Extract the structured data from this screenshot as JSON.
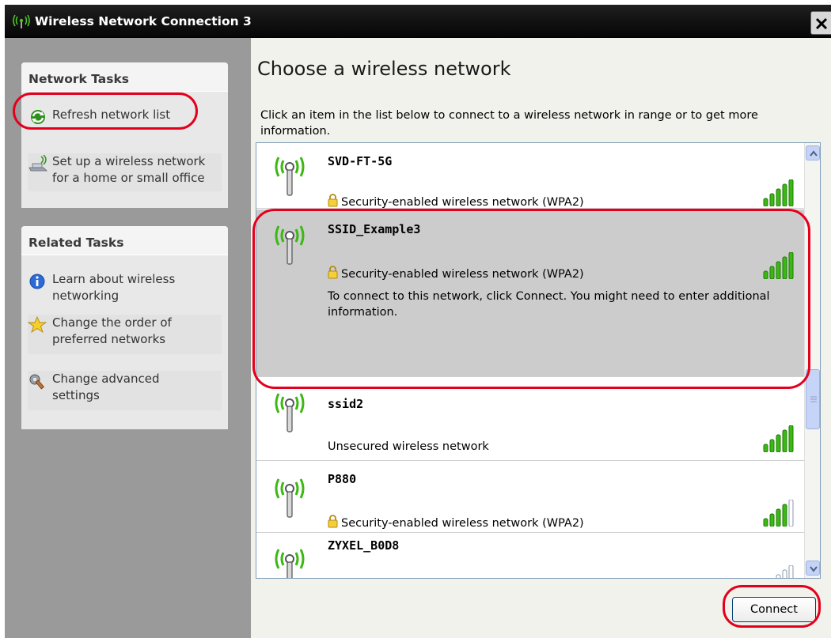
{
  "window": {
    "title": "Wireless Network Connection 3"
  },
  "sidebar": {
    "network_tasks": {
      "header": "Network Tasks",
      "items": [
        {
          "label": "Refresh network list",
          "icon": "refresh-icon"
        },
        {
          "label": "Set up a wireless network\nfor a home or small office",
          "icon": "wireless-setup-icon"
        }
      ]
    },
    "related_tasks": {
      "header": "Related Tasks",
      "items": [
        {
          "label": "Learn about wireless\nnetworking",
          "icon": "info-icon"
        },
        {
          "label": "Change the order of\npreferred networks",
          "icon": "star-icon"
        },
        {
          "label": "Change advanced\nsettings",
          "icon": "settings-icon"
        }
      ]
    }
  },
  "main": {
    "heading": "Choose a wireless network",
    "instruction": "Click an item in the list below to connect to a wireless network in range or to get more information.",
    "networks": [
      {
        "name": "SVD-FT-5G",
        "security": "Security-enabled wireless network (WPA2)",
        "secured": true,
        "signal_bars": 5
      },
      {
        "name": "SSID_Example3",
        "security": "Security-enabled wireless network (WPA2)",
        "secured": true,
        "signal_bars": 5,
        "selected": true,
        "description": "To connect to this network, click Connect. You might need to enter additional information."
      },
      {
        "name": "ssid2",
        "security": "Unsecured wireless network",
        "secured": false,
        "signal_bars": 5
      },
      {
        "name": "P880",
        "security": "Security-enabled wireless network (WPA2)",
        "secured": true,
        "signal_bars": 4
      },
      {
        "name": "ZYXEL_B0D8",
        "security": "",
        "secured": true,
        "signal_bars": 2
      }
    ],
    "connect_label": "Connect"
  },
  "colors": {
    "highlight": "#e4001c",
    "signal_green": "#3cb814",
    "selected_row": "#cccccc"
  }
}
